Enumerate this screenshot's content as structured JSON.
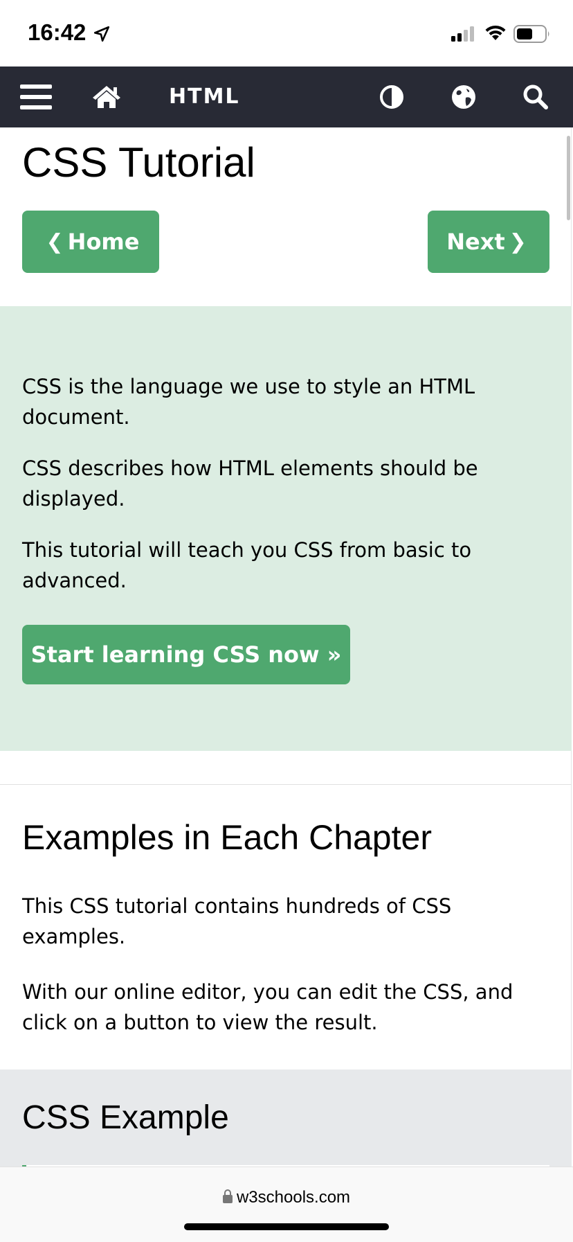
{
  "status_bar": {
    "time": "16:42",
    "icons": [
      "location-arrow-icon",
      "cellular-signal-icon",
      "wifi-icon",
      "battery-icon"
    ]
  },
  "topnav": {
    "title": "HTML",
    "icons": [
      "menu-icon",
      "home-icon",
      "contrast-icon",
      "globe-icon",
      "search-icon"
    ],
    "background": "#282A35"
  },
  "page": {
    "title": "CSS Tutorial",
    "home_button": "Home",
    "next_button": "Next",
    "accent_color": "#4FA86F"
  },
  "intro": {
    "p1": "CSS is the language we use to style an HTML document.",
    "p2": "CSS describes how HTML elements should be displayed.",
    "p3": "This tutorial will teach you CSS from basic to advanced.",
    "start_button": "Start learning CSS now »",
    "background": "#DCEDE2"
  },
  "examples": {
    "title": "Examples in Each Chapter",
    "p1": "This CSS tutorial contains hundreds of CSS examples.",
    "p2": "With our online editor, you can edit the CSS, and click on a button to view the result."
  },
  "css_example": {
    "title": "CSS Example"
  },
  "browser": {
    "url": "w3schools.com"
  }
}
